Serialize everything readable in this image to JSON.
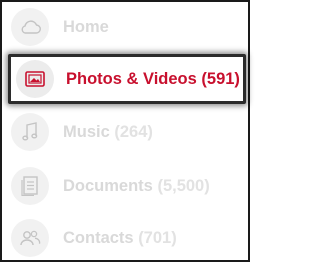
{
  "menu": {
    "items": [
      {
        "label": "Home",
        "count": "",
        "icon": "cloud-icon"
      },
      {
        "label": "Photos & Videos",
        "count": "(591)",
        "icon": "photo-icon",
        "selected": true
      },
      {
        "label": "Music",
        "count": "(264)",
        "icon": "music-note-icon"
      },
      {
        "label": "Documents",
        "count": "(5,500)",
        "icon": "document-icon"
      },
      {
        "label": "Contacts",
        "count": "(701)",
        "icon": "contacts-icon"
      }
    ]
  },
  "colors": {
    "accent": "#c8102e",
    "inactive_text": "#d9d9d9",
    "icon_background": "#f1f1f1"
  }
}
